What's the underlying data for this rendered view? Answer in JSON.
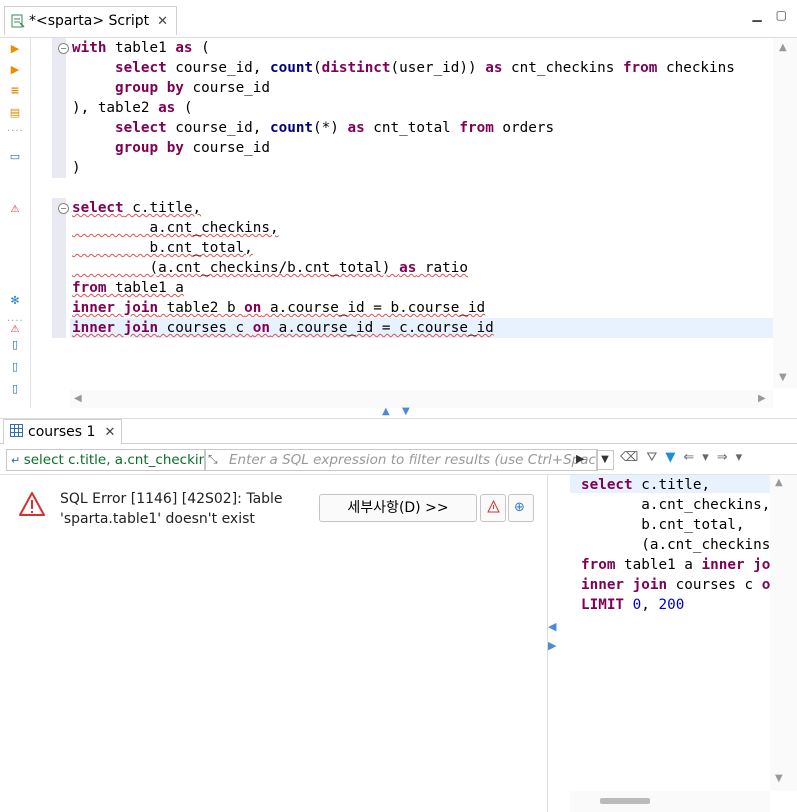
{
  "editor": {
    "tab_label": "*<sparta> Script",
    "code_lines": [
      [
        {
          "t": "with",
          "c": "kw"
        },
        {
          "t": " table1 "
        },
        {
          "t": "as",
          "c": "kw"
        },
        {
          "t": " ("
        }
      ],
      [
        {
          "t": "     "
        },
        {
          "t": "select",
          "c": "kw"
        },
        {
          "t": " course_id, "
        },
        {
          "t": "count",
          "c": "fn"
        },
        {
          "t": "("
        },
        {
          "t": "distinct",
          "c": "kw"
        },
        {
          "t": "(user_id)) "
        },
        {
          "t": "as",
          "c": "kw"
        },
        {
          "t": " cnt_checkins "
        },
        {
          "t": "from",
          "c": "kw"
        },
        {
          "t": " checkins"
        }
      ],
      [
        {
          "t": "     "
        },
        {
          "t": "group by",
          "c": "kw"
        },
        {
          "t": " course_id"
        }
      ],
      [
        {
          "t": "), table2 "
        },
        {
          "t": "as",
          "c": "kw"
        },
        {
          "t": " ("
        }
      ],
      [
        {
          "t": "     "
        },
        {
          "t": "select",
          "c": "kw"
        },
        {
          "t": " course_id, "
        },
        {
          "t": "count",
          "c": "fn"
        },
        {
          "t": "(*) "
        },
        {
          "t": "as",
          "c": "kw"
        },
        {
          "t": " cnt_total "
        },
        {
          "t": "from",
          "c": "kw"
        },
        {
          "t": " orders"
        }
      ],
      [
        {
          "t": "     "
        },
        {
          "t": "group by",
          "c": "kw"
        },
        {
          "t": " course_id"
        }
      ],
      [
        {
          "t": ")"
        }
      ],
      [
        {
          "t": ""
        }
      ],
      [
        {
          "t": "select",
          "c": "kw err"
        },
        {
          "t": " c.title,",
          "c": "err"
        }
      ],
      [
        {
          "t": "         a.cnt_checkins,",
          "c": "err"
        }
      ],
      [
        {
          "t": "         b.cnt_total,",
          "c": "err"
        }
      ],
      [
        {
          "t": "         (a.cnt_checkins/b.cnt_total) ",
          "c": "err"
        },
        {
          "t": "as",
          "c": "kw err"
        },
        {
          "t": " ratio",
          "c": "err"
        }
      ],
      [
        {
          "t": "from",
          "c": "kw err"
        },
        {
          "t": " table1 a",
          "c": "err"
        }
      ],
      [
        {
          "t": "inner join",
          "c": "kw err"
        },
        {
          "t": " table2 b ",
          "c": "err"
        },
        {
          "t": "on",
          "c": "kw err"
        },
        {
          "t": " a.course_id = b.course_id",
          "c": "err"
        }
      ],
      [
        {
          "t": "inner join",
          "c": "kw err"
        },
        {
          "t": " courses c ",
          "c": "err"
        },
        {
          "t": "on",
          "c": "kw err"
        },
        {
          "t": " a.course_id = c.course_id",
          "c": "err"
        }
      ]
    ]
  },
  "results": {
    "tab_label": "courses 1",
    "filter_sql": "select c.title, a.cnt_checkins",
    "filter_placeholder": "Enter a SQL expression to filter results (use Ctrl+Space)",
    "error_message": "SQL Error [1146] [42S02]: Table 'sparta.table1' doesn't exist",
    "details_button": "세부사항(D) >>",
    "query_lines": [
      [
        {
          "t": "select",
          "c": "kw"
        },
        {
          "t": " c.title,"
        }
      ],
      [
        {
          "t": "       a.cnt_checkins,"
        }
      ],
      [
        {
          "t": "       b.cnt_total,"
        }
      ],
      [
        {
          "t": "       (a.cnt_checkins/b.cnt_total)"
        }
      ],
      [
        {
          "t": "from",
          "c": "kw"
        },
        {
          "t": " table1 a "
        },
        {
          "t": "inner",
          "c": "kw"
        },
        {
          "t": " "
        },
        {
          "t": "join",
          "c": "kw"
        }
      ],
      [
        {
          "t": "inner join",
          "c": "kw"
        },
        {
          "t": " courses c "
        },
        {
          "t": "on",
          "c": "kw"
        }
      ],
      [
        {
          "t": "LIMIT",
          "c": "kw"
        },
        {
          "t": " "
        },
        {
          "t": "0",
          "c": "num"
        },
        {
          "t": ", "
        },
        {
          "t": "200",
          "c": "num"
        }
      ]
    ]
  },
  "icons": {
    "editor_tab": "sql-script-icon",
    "error": "error-triangle-icon",
    "results_tab": "grid-table-icon"
  },
  "colors": {
    "keyword": "#7f0055",
    "function": "#000080",
    "error": "#e05050",
    "current_line": "#e8f2fe",
    "filter_text": "#0a6d2c"
  }
}
